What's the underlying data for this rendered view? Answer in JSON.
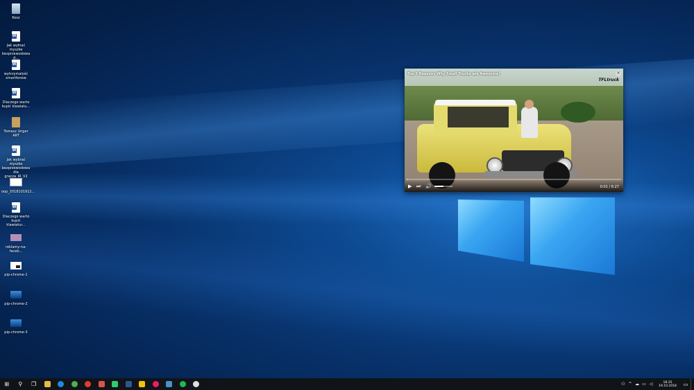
{
  "desktop": {
    "icons": [
      {
        "label": "Kosz",
        "icon": "recycle-bin-icon"
      },
      {
        "label": "Jak wyłnać myszke bezprzewodowa d...",
        "icon": "word-document-icon"
      },
      {
        "label": "wytrzymalość smartfonów",
        "icon": "word-document-icon"
      },
      {
        "label": "Dlaczego warto kupić klawiatu...",
        "icon": "word-document-icon"
      },
      {
        "label": "Tomasz Unger ART",
        "icon": "book-icon"
      },
      {
        "label": "Jak wybrać myszke bezprzewodowa dla gracza_IR_V2",
        "icon": "word-document-icon"
      },
      {
        "label": "oop_2018101912...",
        "icon": "image-file-icon"
      },
      {
        "label": "Dlaczego warto kupić klawiatur...",
        "icon": "word-document-icon"
      },
      {
        "label": "reklamy-na-faceb...",
        "icon": "image-file-icon"
      },
      {
        "label": "pip-chrome-1",
        "icon": "image-file-icon"
      },
      {
        "label": "pip-chrome-2",
        "icon": "image-file-icon"
      },
      {
        "label": "pip-chrome-3",
        "icon": "image-file-icon"
      }
    ]
  },
  "video": {
    "title": "Top 5 Reasons Why Small Trucks are Awesome!",
    "close_glyph": "×",
    "channel_logo": "TFLtruck",
    "time": "0:01 / 6:27",
    "progress": 0.003,
    "volume": 0.5,
    "play_glyph": "▶",
    "next_glyph": "⏭",
    "volume_glyph": "🔊"
  },
  "taskbar": {
    "start_glyph": "⊞",
    "search_glyph": "⚲",
    "taskview_glyph": "❐",
    "apps": [
      {
        "name": "file-explorer",
        "color": "#e8b84a"
      },
      {
        "name": "edge",
        "color": "#1e88e5"
      },
      {
        "name": "chrome",
        "color": "#4caf50"
      },
      {
        "name": "opera",
        "color": "#e53935"
      },
      {
        "name": "photos",
        "color": "#d9534f"
      },
      {
        "name": "green-app",
        "color": "#2ecc71"
      },
      {
        "name": "word",
        "color": "#2b5797"
      },
      {
        "name": "drive",
        "color": "#f4c20d"
      },
      {
        "name": "paint",
        "color": "#e91e63"
      },
      {
        "name": "teamviewer",
        "color": "#4a90c8"
      },
      {
        "name": "spotify",
        "color": "#1db954"
      },
      {
        "name": "steam",
        "color": "#dddddd"
      }
    ],
    "tray": {
      "up_glyph": "^",
      "time": "18:35",
      "date": "19.10.2018",
      "notif_glyph": "▭"
    }
  }
}
